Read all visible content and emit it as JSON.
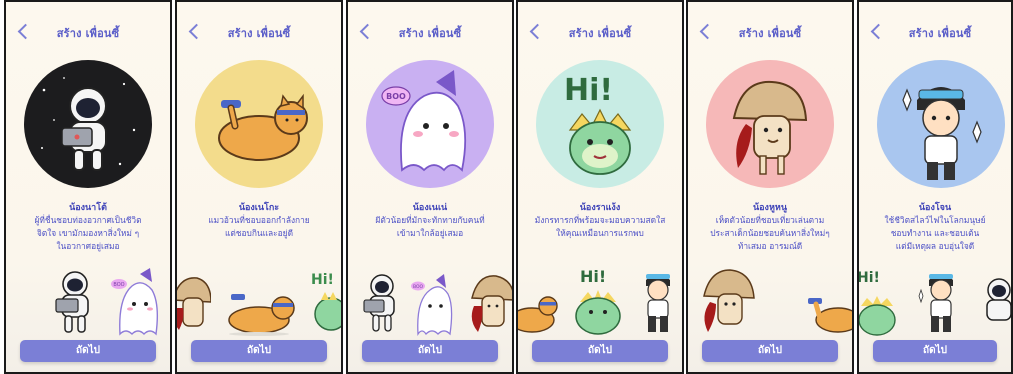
{
  "screens": [
    {
      "title": "สร้าง เพื่อนซี้",
      "name": "น้องนาโต้",
      "desc": [
        "ผู้ที่ชื่นชอบท่องอวกาศเป็นชีวิต",
        "จิตใจ เขามักมองหาสิ่งใหม่ ๆ",
        "ในอวกาศอยู่เสมอ"
      ],
      "circle_color": "#1c1c1e",
      "character": "astronaut",
      "stickers": [
        "astronaut",
        "ghost"
      ],
      "button": "ถัดไป"
    },
    {
      "title": "สร้าง เพื่อนซี้",
      "name": "น้องเนโกะ",
      "desc": [
        "แมวอ้วนที่ชอบออกกำลังกาย",
        "แต่ชอบกินและอยู่ดี"
      ],
      "circle_color": "#f3dc8c",
      "character": "cat",
      "stickers": [
        "mushroom",
        "cat",
        "dragon"
      ],
      "button": "ถัดไป"
    },
    {
      "title": "สร้าง เพื่อนซี้",
      "name": "น้องเนเน่",
      "desc": [
        "ผีตัวน้อยที่มักจะทักทายกับคนที่",
        "เข้ามาใกล้อยู่เสมอ"
      ],
      "circle_color": "#c9b0f2",
      "character": "ghost",
      "boo": "BOO",
      "stickers": [
        "astronaut",
        "ghost",
        "mushroom"
      ],
      "button": "ถัดไป"
    },
    {
      "title": "สร้าง เพื่อนซี้",
      "name": "น้องราแง้ง",
      "desc": [
        "มังกรทารกที่พร้อมจะมอบความสดใส",
        "ให้คุณเหมือนการแรกพบ"
      ],
      "circle_color": "#c8ece4",
      "character": "dragon",
      "hi": "Hi!",
      "stickers": [
        "cat",
        "dragon",
        "boy"
      ],
      "button": "ถัดไป"
    },
    {
      "title": "สร้าง เพื่อนซี้",
      "name": "น้องหูหนู",
      "desc": [
        "เห็ดตัวน้อยที่ชอบเที่ยวเล่นตาม",
        "ประสาเด็กน้อยชอบค้นหาสิ่งใหม่ๆ",
        "ท้าเสมอ อารมณ์ดี"
      ],
      "circle_color": "#f6b8b8",
      "character": "mushroom",
      "stickers": [
        "mushroom",
        "cat"
      ],
      "button": "ถัดไป"
    },
    {
      "title": "สร้าง เพื่อนซี้",
      "name": "น้องโจน",
      "desc": [
        "ใช้ชีวิตสไลว์ไฟในโลกมนุษย์",
        "ชอบทำงาน และชอบเต้น",
        "แต่มีเหตุผล อบอุ่นใจดี"
      ],
      "circle_color": "#a9c6ef",
      "character": "boy",
      "stickers": [
        "dragon",
        "boy",
        "astronaut"
      ],
      "button": "ถัดไป"
    }
  ],
  "sticker_hi": "Hi!",
  "sticker_boo": "BOO"
}
